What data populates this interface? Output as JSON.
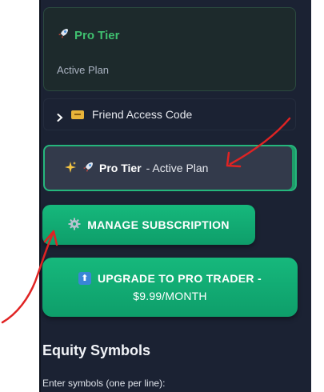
{
  "sidebar": {
    "plan_card": {
      "icon": "rocket-icon",
      "title": "Pro Tier",
      "subtitle": "Active Plan",
      "title_color": "#3fbf6f"
    },
    "friend_code": {
      "chevron": "chevron-right-icon",
      "icon": "ticket-icon",
      "label": "Friend Access Code"
    },
    "active_plan_banner": {
      "icons": [
        "sparkles-icon",
        "rocket-icon"
      ],
      "bold": "Pro Tier",
      "rest": "- Active Plan",
      "border_color": "#25b67c"
    },
    "manage_button": {
      "icon": "gear-icon",
      "label": "MANAGE SUBSCRIPTION"
    },
    "upgrade_button": {
      "icon": "up-arrow-icon",
      "line1": "UPGRADE TO PRO TRADER -",
      "line2": "$9.99/MONTH"
    },
    "equity": {
      "title": "Equity Symbols",
      "input_label": "Enter symbols (one per line):"
    }
  },
  "colors": {
    "sidebar_bg": "#1b2233",
    "button_green": "#16b87c",
    "annotation_red": "#e02323"
  }
}
